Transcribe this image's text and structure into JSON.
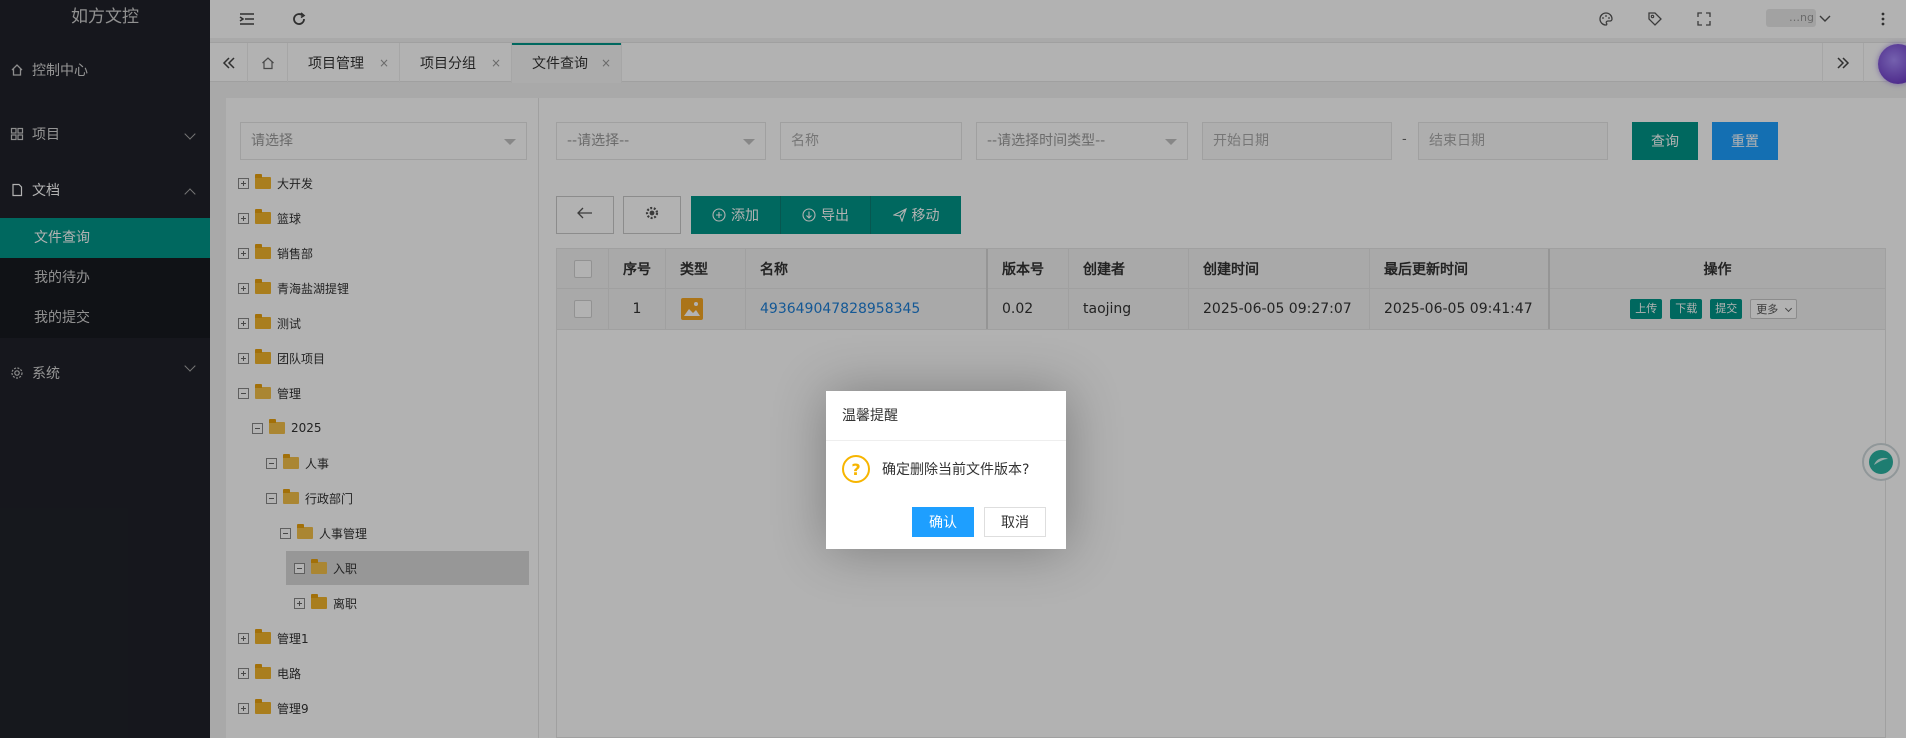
{
  "app": {
    "title": "如方文控"
  },
  "sidebar": {
    "items": [
      {
        "label": "控制中心",
        "icon": "home-icon"
      },
      {
        "label": "项目",
        "icon": "grid-icon"
      },
      {
        "label": "文档",
        "icon": "document-icon"
      },
      {
        "label": "系统",
        "icon": "gear-icon"
      }
    ],
    "sub_items": [
      {
        "label": "文件查询",
        "active": true
      },
      {
        "label": "我的待办",
        "active": false
      },
      {
        "label": "我的提交",
        "active": false
      }
    ]
  },
  "header": {
    "icons": [
      "menu-fold-icon",
      "refresh-icon",
      "palette-icon",
      "tag-icon",
      "fullscreen-icon",
      "user-dropdown-icon",
      "more-vertical-icon"
    ],
    "user_name": "…ng"
  },
  "tabs": [
    {
      "label": "项目管理",
      "close": "×"
    },
    {
      "label": "项目分组",
      "close": "×"
    },
    {
      "label": "文件查询",
      "close": "×",
      "active": true
    }
  ],
  "tree": {
    "select_placeholder": "请选择",
    "nodes": [
      {
        "label": "大开发",
        "expanded": false,
        "level": 0
      },
      {
        "label": "篮球",
        "expanded": false,
        "level": 0
      },
      {
        "label": "销售部",
        "expanded": false,
        "level": 0
      },
      {
        "label": "青海盐湖提锂",
        "expanded": false,
        "level": 0
      },
      {
        "label": "测试",
        "expanded": false,
        "level": 0
      },
      {
        "label": "团队项目",
        "expanded": false,
        "level": 0
      },
      {
        "label": "管理",
        "expanded": true,
        "level": 0
      },
      {
        "label": "2025",
        "expanded": true,
        "level": 1
      },
      {
        "label": "人事",
        "expanded": true,
        "level": 2
      },
      {
        "label": "行政部门",
        "expanded": true,
        "level": 2
      },
      {
        "label": "人事管理",
        "expanded": true,
        "level": 3
      },
      {
        "label": "入职",
        "expanded": true,
        "level": 4,
        "selected": true
      },
      {
        "label": "离职",
        "expanded": false,
        "level": 4
      },
      {
        "label": "管理1",
        "expanded": false,
        "level": 0
      },
      {
        "label": "电路",
        "expanded": false,
        "level": 0
      },
      {
        "label": "管理9",
        "expanded": false,
        "level": 0
      }
    ]
  },
  "filters": {
    "type_placeholder": "--请选择--",
    "name_placeholder": "名称",
    "time_type_placeholder": "--请选择时间类型--",
    "start_placeholder": "开始日期",
    "dash": "-",
    "end_placeholder": "结束日期",
    "query_label": "查询",
    "reset_label": "重置"
  },
  "toolbar": {
    "back_icon": "arrow-left-icon",
    "settings_icon": "gear-icon",
    "add_label": "添加",
    "export_label": "导出",
    "move_label": "移动"
  },
  "table": {
    "headers": [
      "序号",
      "类型",
      "名称",
      "版本号",
      "创建者",
      "创建时间",
      "最后更新时间",
      "操作"
    ],
    "rows": [
      {
        "index": "1",
        "type_icon": "image-file-icon",
        "name": "493649047828958345",
        "version": "0.02",
        "creator": "taojing",
        "created": "2025-06-05 09:27:07",
        "updated": "2025-06-05 09:41:47",
        "actions": [
          "上传",
          "下载",
          "提交",
          "更多"
        ]
      }
    ]
  },
  "dialog": {
    "title": "温馨提醒",
    "message": "确定删除当前文件版本?",
    "ok_label": "确认",
    "cancel_label": "取消",
    "icon": "question-icon"
  },
  "colors": {
    "sidebar_bg": "#20222a",
    "accent": "#009688",
    "primary_blue": "#1e9fff",
    "folder": "#f2b52b"
  }
}
